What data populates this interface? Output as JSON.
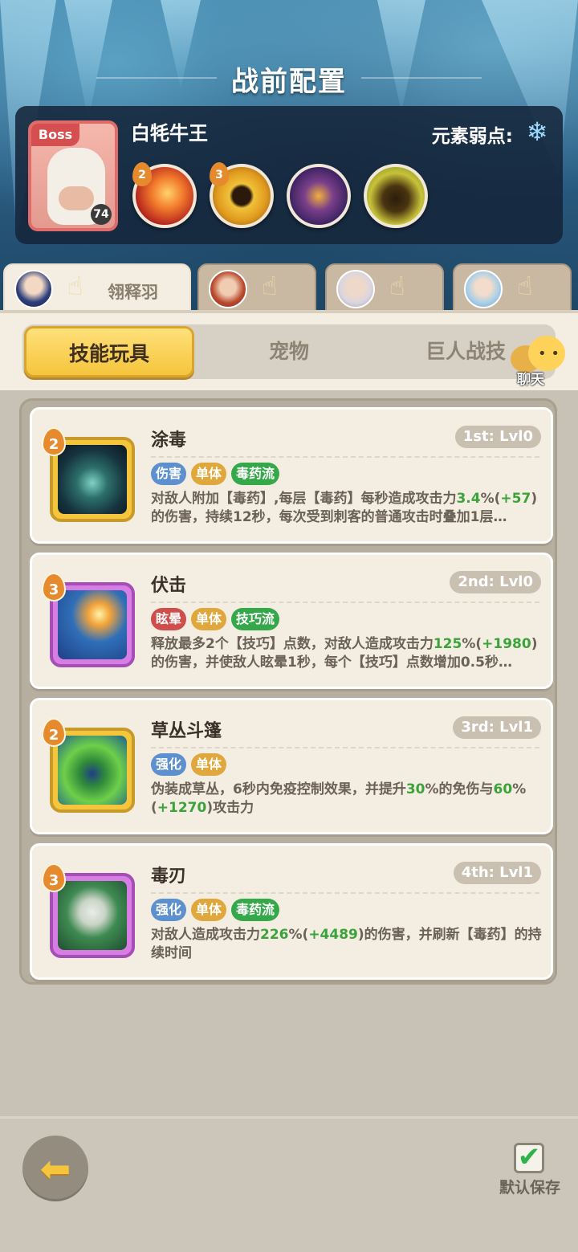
{
  "header": {
    "title": "战前配置"
  },
  "boss": {
    "tag": "Boss",
    "name": "白牦牛王",
    "level": "74",
    "weakness_label": "元素弱点:",
    "weakness_icon": "snowflake-icon",
    "skills": [
      {
        "rank": "2",
        "icon": "fire-claw-icon"
      },
      {
        "rank": "3",
        "icon": "golden-ring-icon"
      },
      {
        "rank": "",
        "icon": "roaring-beast-icon"
      },
      {
        "rank": "",
        "icon": "shadow-beast-icon"
      }
    ]
  },
  "heroes": [
    {
      "name": "翎释羽",
      "active": true
    },
    {
      "name": "",
      "active": false
    },
    {
      "name": "",
      "active": false
    },
    {
      "name": "",
      "active": false
    }
  ],
  "categories": [
    {
      "label": "技能玩具",
      "active": true
    },
    {
      "label": "宠物",
      "active": false
    },
    {
      "label": "巨人战技",
      "active": false
    }
  ],
  "chat": {
    "label": "聊天"
  },
  "skills": [
    {
      "name": "涂毒",
      "level": "1st: Lvl0",
      "rank": "2",
      "frame": "gold",
      "icon": "poison-drop-icon",
      "tags": [
        {
          "text": "伤害",
          "color": "blue"
        },
        {
          "text": "单体",
          "color": "orange"
        },
        {
          "text": "毒药流",
          "color": "green"
        }
      ],
      "desc_parts": [
        "对敌人附加【毒药】,每层【毒药】每秒造成攻击力",
        "3.4",
        "%(",
        "+57",
        ")的伤害，持续12秒，每次受到刺客的普通攻击时叠加1层…"
      ]
    },
    {
      "name": "伏击",
      "level": "2nd: Lvl0",
      "rank": "3",
      "frame": "purple",
      "icon": "ambush-icon",
      "tags": [
        {
          "text": "眩晕",
          "color": "red"
        },
        {
          "text": "单体",
          "color": "orange"
        },
        {
          "text": "技巧流",
          "color": "green"
        }
      ],
      "desc_parts": [
        "释放最多2个【技巧】点数，对敌人造成攻击力",
        "125",
        "%(",
        "+1980",
        ")的伤害，并使敌人眩晕1秒，每个【技巧】点数增加0.5秒…"
      ]
    },
    {
      "name": "草丛斗篷",
      "level": "3rd: Lvl1",
      "rank": "2",
      "frame": "gold",
      "icon": "bush-cloak-icon",
      "tags": [
        {
          "text": "强化",
          "color": "blue"
        },
        {
          "text": "单体",
          "color": "orange"
        }
      ],
      "desc_parts": [
        "伪装成草丛，6秒内免疫控制效果，并提升",
        "30",
        "%的免伤与",
        "60",
        "%(",
        "+1270",
        ")攻击力"
      ]
    },
    {
      "name": "毒刃",
      "level": "4th: Lvl1",
      "rank": "3",
      "frame": "purple",
      "icon": "poison-skull-icon",
      "tags": [
        {
          "text": "强化",
          "color": "blue"
        },
        {
          "text": "单体",
          "color": "orange"
        },
        {
          "text": "毒药流",
          "color": "green"
        }
      ],
      "desc_parts": [
        "对敌人造成攻击力",
        "226",
        "%(",
        "+4489",
        ")的伤害，并刷新【毒药】的持续时间"
      ]
    }
  ],
  "footer": {
    "back_icon": "back-arrow-icon",
    "save_label": "默认保存",
    "save_checked": true
  },
  "colors": {
    "accent_gold": "#f5c53c",
    "highlight_green": "#3ba33a",
    "panel_bg": "#f3ede2"
  }
}
